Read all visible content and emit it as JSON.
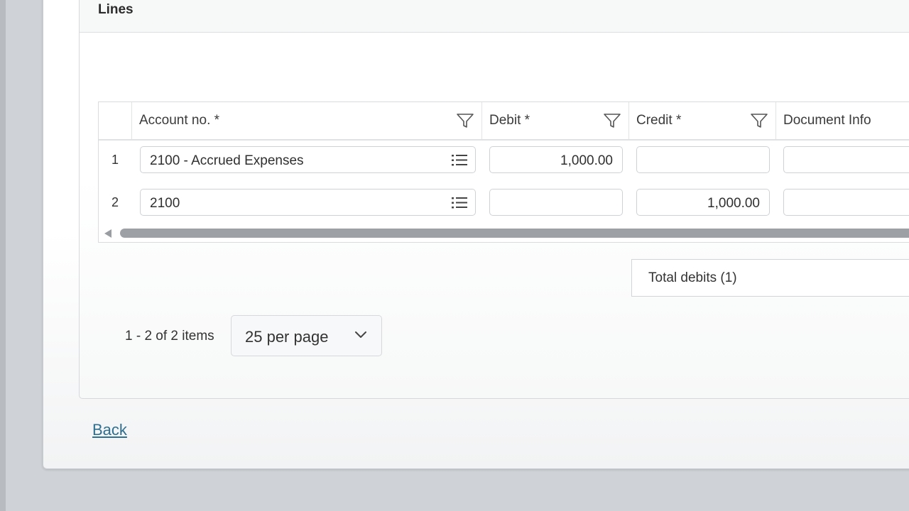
{
  "section": {
    "title": "Lines"
  },
  "grid": {
    "columns": [
      {
        "label": "Account no. *",
        "filter_icon": "filter-icon"
      },
      {
        "label": "Debit *",
        "filter_icon": "filter-icon"
      },
      {
        "label": "Credit *",
        "filter_icon": "filter-icon"
      },
      {
        "label": "Document Info"
      }
    ],
    "rows": [
      {
        "num": "1",
        "account": "2100 - Accrued Expenses",
        "debit": "1,000.00",
        "credit": "",
        "document_info": ""
      },
      {
        "num": "2",
        "account": "2100",
        "debit": "",
        "credit": "1,000.00",
        "document_info": ""
      }
    ]
  },
  "totals": {
    "label": "Total debits (1)"
  },
  "pager": {
    "info": "1 - 2 of 2 items",
    "per_page": "25 per page"
  },
  "footer": {
    "back_label": "Back"
  }
}
